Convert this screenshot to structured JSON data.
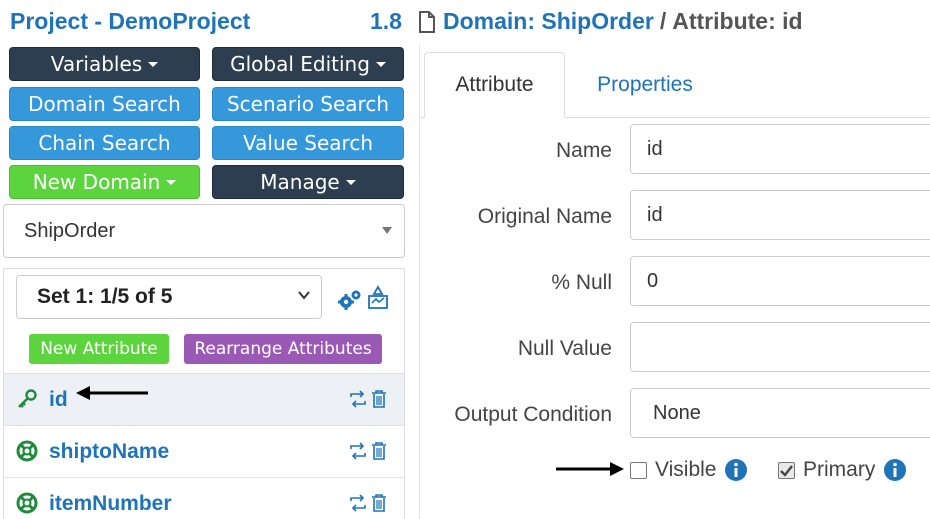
{
  "header": {
    "project_title": "Project - DemoProject",
    "version": "1.8",
    "breadcrumb_domain": "Domain: ShipOrder",
    "breadcrumb_sep": "/",
    "breadcrumb_attribute": "Attribute: id"
  },
  "buttons": {
    "variables": "Variables",
    "global_editing": "Global Editing",
    "domain_search": "Domain Search",
    "scenario_search": "Scenario Search",
    "chain_search": "Chain Search",
    "value_search": "Value Search",
    "new_domain": "New Domain",
    "manage": "Manage"
  },
  "domain_select": {
    "value": "ShipOrder"
  },
  "attributes_panel": {
    "set_select": "Set 1: 1/5 of 5",
    "new_attribute": "New Attribute",
    "rearrange_attributes": "Rearrange Attributes",
    "rows": [
      {
        "name": "id",
        "icon": "key-icon"
      },
      {
        "name": "shiptoName",
        "icon": "lifebuoy-icon"
      },
      {
        "name": "itemNumber",
        "icon": "lifebuoy-icon"
      }
    ]
  },
  "tabs": {
    "attribute": "Attribute",
    "properties": "Properties"
  },
  "form": {
    "name_label": "Name",
    "name_value": "id",
    "original_name_label": "Original Name",
    "original_name_value": "id",
    "percent_null_label": "% Null",
    "percent_null_value": "0",
    "null_value_label": "Null Value",
    "null_value_value": "",
    "output_condition_label": "Output Condition",
    "output_condition_value": "None",
    "visible_label": "Visible",
    "visible_checked": false,
    "primary_label": "Primary",
    "primary_checked": true
  },
  "colors": {
    "link_blue": "#1f73b7",
    "dark_button": "#2c3e50",
    "blue_button": "#3498db",
    "green_button": "#5cd43d",
    "purple_button": "#9b59b6",
    "icon_green": "#1e8a3c"
  }
}
